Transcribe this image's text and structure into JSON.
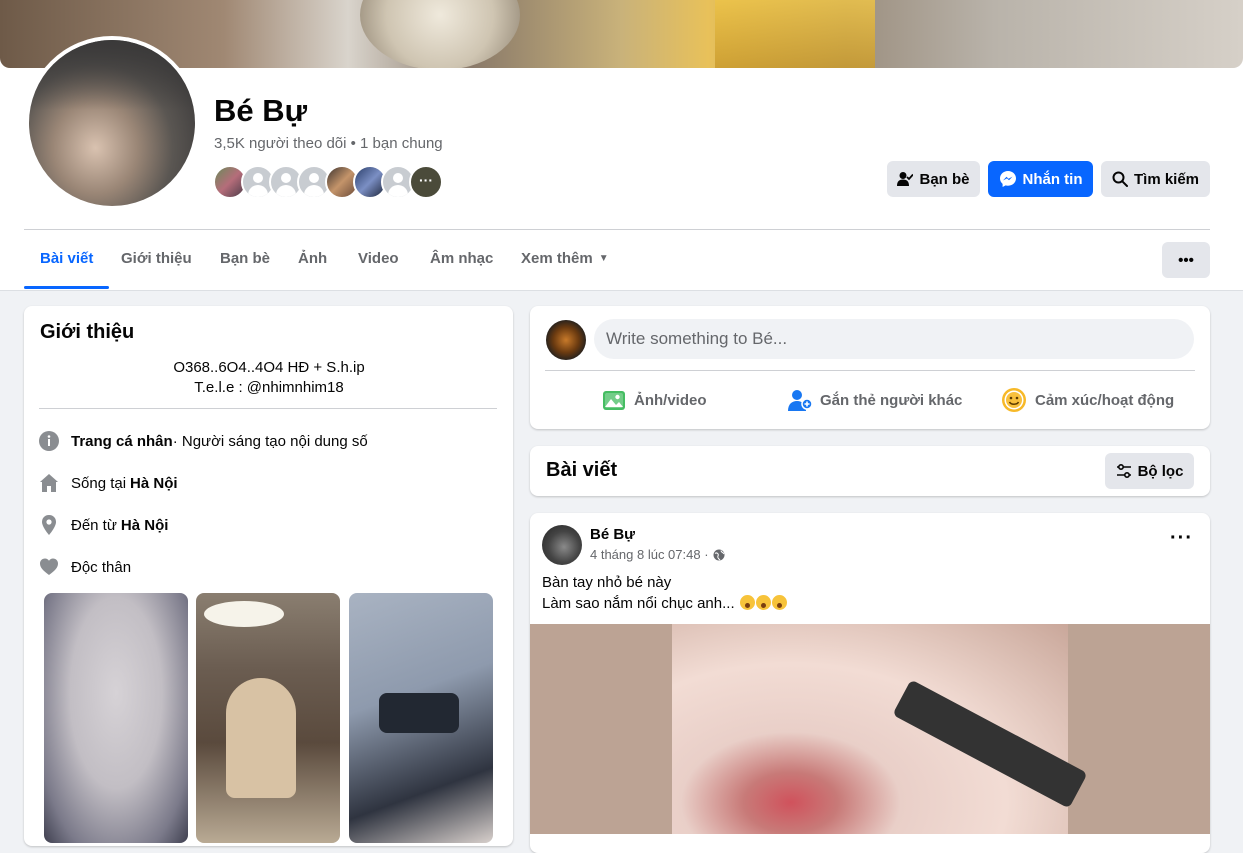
{
  "profile": {
    "name": "Bé Bự",
    "meta": "3,5K người theo dõi • 1 bạn chung"
  },
  "actions": {
    "friends_label": "Bạn bè",
    "message_label": "Nhắn tin",
    "search_label": "Tìm kiếm",
    "more_label": "•••"
  },
  "tabs": [
    {
      "label": "Bài viết"
    },
    {
      "label": "Giới thiệu"
    },
    {
      "label": "Bạn bè"
    },
    {
      "label": "Ảnh"
    },
    {
      "label": "Video"
    },
    {
      "label": "Âm nhạc"
    },
    {
      "label": "Xem thêm"
    }
  ],
  "intro": {
    "title": "Giới thiệu",
    "bio_line1": "O368..6O4..4O4 HĐ + S.h.ip",
    "bio_line2": "T.e.l.e : @nhimnhim18",
    "profile_type_strong": "Trang cá nhân",
    "profile_type_rest": " · Người sáng tạo nội dung số",
    "lives_prefix": "Sống tại ",
    "lives_city": "Hà Nội",
    "from_prefix": "Đến từ ",
    "from_city": "Hà Nội",
    "relationship": "Độc thân"
  },
  "composer": {
    "placeholder": "Write something to Bé...",
    "photo_video": "Ảnh/video",
    "tag_people": "Gắn thẻ người khác",
    "feeling": "Cảm xúc/hoạt động"
  },
  "posts_section": {
    "title": "Bài viết",
    "filter_label": "Bộ lọc"
  },
  "post": {
    "author": "Bé Bự",
    "time": "4 tháng 8 lúc 07:48 ·",
    "line1": "Bàn tay nhỏ bé này",
    "line2": "Làm sao nắm nổi chục anh..."
  },
  "colors": {
    "accent": "#0866ff",
    "background": "#f0f2f5",
    "secondary_text": "#65676b"
  }
}
